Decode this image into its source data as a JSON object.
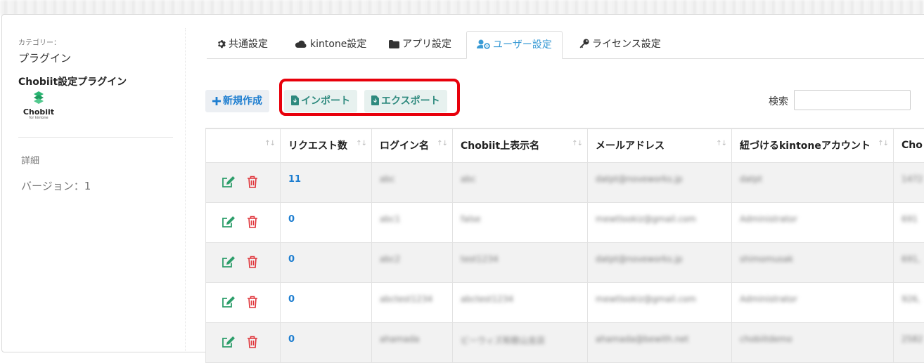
{
  "sidebar": {
    "category_label": "カテゴリー：",
    "category_value": "プラグイン",
    "plugin_name": "Chobiit設定プラグイン",
    "logo_text": "Chobiit",
    "logo_subtext": "for kintone",
    "detail_label": "詳細",
    "version_text": "バージョン：1"
  },
  "tabs": [
    {
      "label": "共通設定",
      "icon": "gear-icon"
    },
    {
      "label": "kintone設定",
      "icon": "cloud-icon"
    },
    {
      "label": "アプリ設定",
      "icon": "folder-icon"
    },
    {
      "label": "ユーザー設定",
      "icon": "user-gear-icon",
      "active": true
    },
    {
      "label": "ライセンス設定",
      "icon": "key-icon"
    }
  ],
  "toolbar": {
    "new_label": "新規作成",
    "import_label": "インポート",
    "export_label": "エクスポート",
    "search_label": "検索",
    "search_value": ""
  },
  "table": {
    "headers": [
      "",
      "リクエスト数",
      "ログイン名",
      "Chobiit上表示名",
      "メールアドレス",
      "紐づけるkintoneアカウント",
      "Cho"
    ],
    "rows": [
      {
        "requests": "11",
        "login": "abc",
        "display": "abc",
        "email": "datpt@noveworks.jp",
        "account": "datpt",
        "extra": "1472"
      },
      {
        "requests": "0",
        "login": "abc1",
        "display": "false",
        "email": "mewtlookiz@gmail.com",
        "account": "Administrator",
        "extra": "691"
      },
      {
        "requests": "0",
        "login": "abc2",
        "display": "test1234",
        "email": "datpt@noveworks.jp",
        "account": "shimomusak",
        "extra": "691,"
      },
      {
        "requests": "0",
        "login": "abctest1234",
        "display": "abctest1234",
        "email": "mewtlookiz@gmail.com",
        "account": "Administrator",
        "extra": "926,"
      },
      {
        "requests": "0",
        "login": "ahamada",
        "display": "ビーウィズ和歌山支店",
        "email": "ahamada@bewith.net",
        "account": "chobiitdemo",
        "extra": "2582"
      }
    ]
  },
  "colors": {
    "accent": "#3a9bd5",
    "link_blue": "#1e7ed0",
    "edit_green": "#2e9e6b",
    "delete_red": "#e0343a",
    "highlight_red": "#e8000b",
    "logo_green": "#2bb673"
  }
}
